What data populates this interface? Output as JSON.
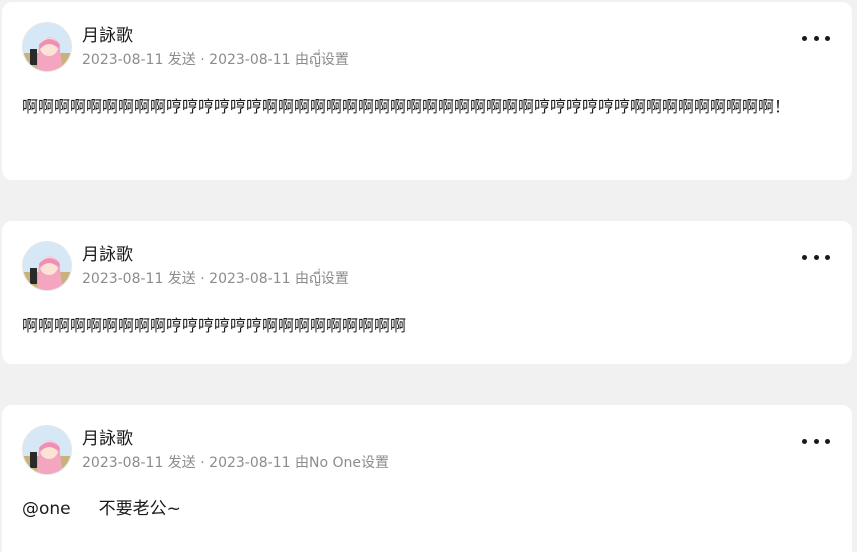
{
  "posts": [
    {
      "author": "月詠歌",
      "meta": "2023-08-11 发送 · 2023-08-11 由ญี่设置",
      "content": "啊啊啊啊啊啊啊啊啊哼哼哼哼哼哼啊啊啊啊啊啊啊啊啊啊啊啊啊啊啊啊啊哼哼哼哼哼哼啊啊啊啊啊啊啊啊啊！"
    },
    {
      "author": "月詠歌",
      "meta": "2023-08-11 发送 · 2023-08-11 由ญี่设置",
      "content": "啊啊啊啊啊啊啊啊啊哼哼哼哼哼哼啊啊啊啊啊啊啊啊啊"
    },
    {
      "author": "月詠歌",
      "meta": "2023-08-11 发送 · 2023-08-11 由No One设置",
      "mention": "@one",
      "content": "不要老公~"
    }
  ],
  "icons": {
    "avatar": "anime-girl-avatar",
    "more": "more-dots-icon"
  }
}
